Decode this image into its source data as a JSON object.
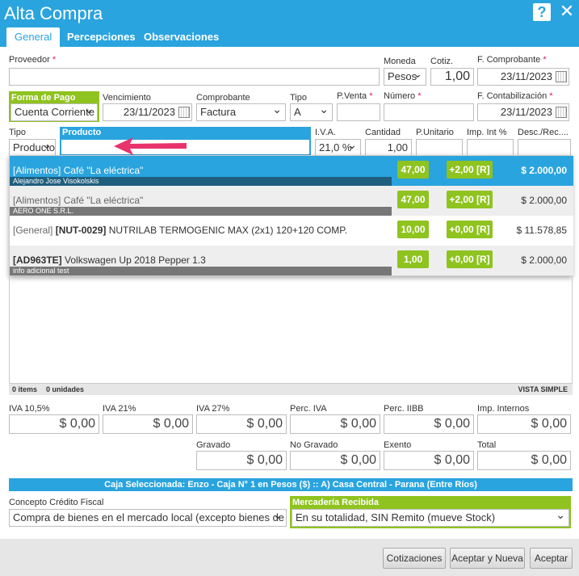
{
  "window": {
    "title": "Alta Compra"
  },
  "tabs": [
    {
      "label": "General"
    },
    {
      "label": "Percepciones"
    },
    {
      "label": "Observaciones"
    }
  ],
  "header": {
    "proveedor_label": "Proveedor",
    "proveedor_value": "",
    "moneda_label": "Moneda",
    "moneda_value": "Pesos",
    "cotiz_label": "Cotiz.",
    "cotiz_value": "1,00",
    "fcomprobante_label": "F. Comprobante",
    "fcomprobante_value": "23/11/2023",
    "forma_pago_label": "Forma de Pago",
    "forma_pago_value": "Cuenta Corriente",
    "vencimiento_label": "Vencimiento",
    "vencimiento_value": "23/11/2023",
    "comprobante_label": "Comprobante",
    "comprobante_value": "Factura",
    "tipo_label": "Tipo",
    "tipo_value": "A",
    "pventa_label": "P.Venta",
    "pventa_value": "",
    "numero_label": "Número",
    "numero_value": "",
    "fcontab_label": "F. Contabilización",
    "fcontab_value": "23/11/2023"
  },
  "item_row": {
    "tipo_label": "Tipo",
    "tipo_value": "Producto",
    "producto_label": "Producto",
    "producto_value": "",
    "iva_label": "I.V.A.",
    "iva_value": "21,0 %",
    "cantidad_label": "Cantidad",
    "cantidad_value": "1,00",
    "punitario_label": "P.Unitario",
    "impint_label": "Imp. Int %",
    "desc_label": "Desc./Rec...."
  },
  "suggestions": [
    {
      "prefix": "[Alimentos] ",
      "code": "",
      "name": "Café \"La eléctrica\"",
      "sub": "Alejandro Jose Visokolskis",
      "stock": "47,00",
      "delta": "+2,00 [R]",
      "price": "$ 2.000,00"
    },
    {
      "prefix": "[Alimentos] ",
      "code": "",
      "name": "Café \"La eléctrica\"",
      "sub": "AERO ONE S.R.L.",
      "stock": "47,00",
      "delta": "+2,00 [R]",
      "price": "$ 2.000,00"
    },
    {
      "prefix": "[General] ",
      "code": "[NUT-0029]",
      "name": " NUTRILAB TERMOGENIC MAX (2x1) 120+120 COMP.",
      "sub": "",
      "stock": "10,00",
      "delta": "+0,00 [R]",
      "price": "$ 11.578,85"
    },
    {
      "prefix": "",
      "code": "[AD963TE]",
      "name": " Volkswagen Up 2018 Pepper 1.3",
      "sub": "info adicional test",
      "stock": "1,00",
      "delta": "+0,00 [R]",
      "price": "$ 2.000,00"
    }
  ],
  "grid_footer": {
    "items": "0 items",
    "unidades": "0 unidades",
    "vista": "VISTA SIMPLE"
  },
  "totals": {
    "iva105_label": "IVA 10,5%",
    "iva105_value": "$ 0,00",
    "iva21_label": "IVA 21%",
    "iva21_value": "$ 0,00",
    "iva27_label": "IVA 27%",
    "iva27_value": "$ 0,00",
    "perciva_label": "Perc. IVA",
    "perciva_value": "$ 0,00",
    "perciibb_label": "Perc. IIBB",
    "perciibb_value": "$ 0,00",
    "impint_label": "Imp. Internos",
    "impint_value": "$ 0,00",
    "gravado_label": "Gravado",
    "gravado_value": "$ 0,00",
    "nogravado_label": "No Gravado",
    "nogravado_value": "$ 0,00",
    "exento_label": "Exento",
    "exento_value": "$ 0,00",
    "total_label": "Total",
    "total_value": "$ 0,00"
  },
  "caja": "Caja Seleccionada: Enzo - Caja N° 1 en Pesos ($) :: A) Casa Central - Parana (Entre Ríos)",
  "footer_fields": {
    "concepto_label": "Concepto Crédito Fiscal",
    "concepto_value": "Compra de bienes en el mercado local (excepto bienes de uso)",
    "mercaderia_label": "Mercadería Recibida",
    "mercaderia_value": "En su totalidad, SIN Remito (mueve Stock)"
  },
  "buttons": {
    "cotizaciones": "Cotizaciones",
    "aceptar_nueva": "Aceptar y Nueva",
    "aceptar": "Aceptar"
  },
  "colors": {
    "accent": "#2aa4de",
    "green": "#8fc31f",
    "required": "#e01a4f",
    "arrow": "#e8336d"
  }
}
